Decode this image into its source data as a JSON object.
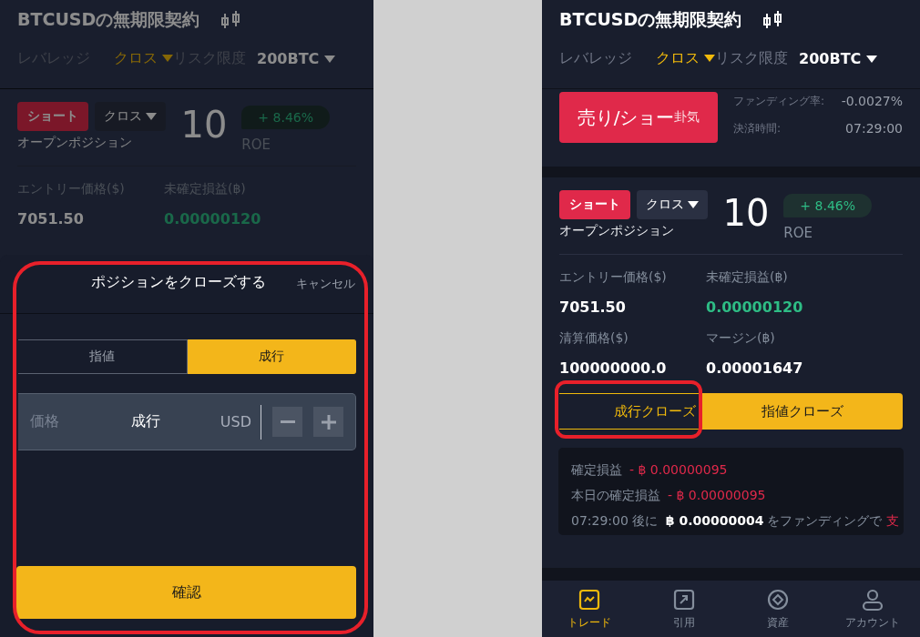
{
  "screens": [
    {
      "kind": "close_dialog",
      "dimmed": true,
      "title": "BTCUSDの無期限契約",
      "leverage": {
        "label": "レバレッジ",
        "mode": "クロス",
        "risk_label": "リスク限度",
        "risk_value": "200BTC"
      },
      "position": {
        "side": "ショート",
        "margin_mode": "クロス",
        "leverage": "10",
        "roe": "+ 8.46%",
        "roe_label": "ROE",
        "status": "オープンポジション",
        "stats": [
          {
            "label": "エントリー価格($)",
            "value": "7051.50",
            "positive": false
          },
          {
            "label": "未確定損益(฿)",
            "value": "0.00000120",
            "positive": true
          }
        ]
      },
      "sheet": {
        "title": "ポジションをクローズする",
        "cancel": "キャンセル",
        "tabs": [
          {
            "label": "指値",
            "selected": false
          },
          {
            "label": "成行",
            "selected": true
          }
        ],
        "price_field": {
          "label": "価格",
          "value": "成行",
          "unit": "USD"
        },
        "confirm": "確認",
        "annotated": true
      }
    },
    {
      "kind": "position",
      "dimmed": false,
      "title": "BTCUSDの無期限契約",
      "leverage": {
        "label": "レバレッジ",
        "mode": "クロス",
        "risk_label": "リスク限度",
        "risk_value": "200BTC"
      },
      "order": {
        "button": "売り/ショー",
        "overlay": "卦気",
        "funding": [
          {
            "label": "ファンディング率:",
            "value": "-0.0027%"
          },
          {
            "label": "決済時間:",
            "value": "07:29:00"
          }
        ]
      },
      "position": {
        "side": "ショート",
        "margin_mode": "クロス",
        "leverage": "10",
        "roe": "+ 8.46%",
        "roe_label": "ROE",
        "status": "オープンポジション",
        "stats": [
          {
            "label": "エントリー価格($)",
            "value": "7051.50",
            "positive": false
          },
          {
            "label": "未確定損益(฿)",
            "value": "0.00000120",
            "positive": true
          },
          {
            "label": "清算価格($)",
            "value": "100000000.0",
            "positive": false
          },
          {
            "label": "マージン(฿)",
            "value": "0.00001647",
            "positive": false
          }
        ]
      },
      "close_buttons": [
        {
          "label": "成行クローズ",
          "kind": "outline",
          "annotated": true
        },
        {
          "label": "指値クローズ",
          "kind": "filled",
          "annotated": false
        }
      ],
      "pnl": {
        "realized_label": "確定損益",
        "realized": "- ฿ 0.00000095",
        "today_label": "本日の確定損益",
        "today": "- ฿ 0.00000095",
        "funding_time": "07:29:00",
        "after": "後に",
        "amount": "฿ 0.00000004",
        "funding_text": "をファンディングで",
        "direction": "支"
      },
      "nav": [
        {
          "label": "トレード",
          "kind": "chart",
          "selected": true
        },
        {
          "label": "引用",
          "kind": "quote",
          "selected": false
        },
        {
          "label": "資産",
          "kind": "assets",
          "selected": false
        },
        {
          "label": "アカウント",
          "kind": "account",
          "selected": false
        }
      ]
    }
  ]
}
